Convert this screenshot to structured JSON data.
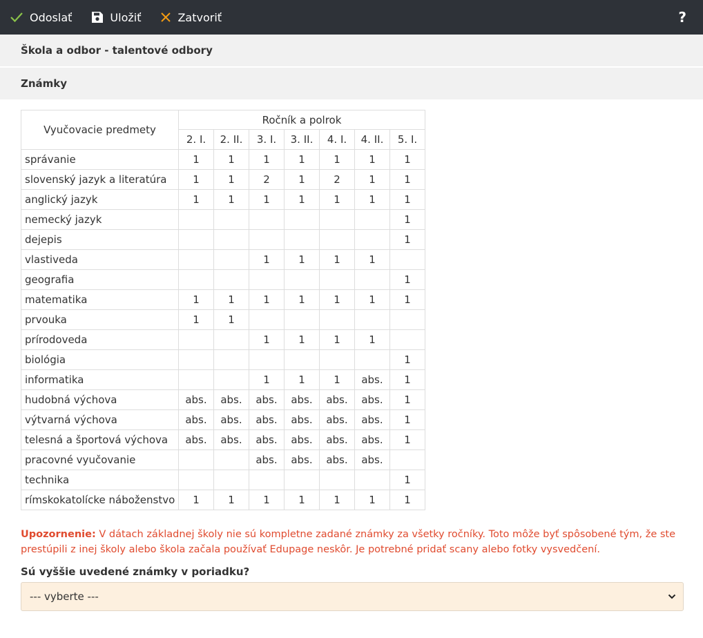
{
  "toolbar": {
    "send_label": "Odoslať",
    "save_label": "Uložiť",
    "close_label": "Zatvoriť",
    "help_label": "?",
    "icons": {
      "send": "checkmark-icon",
      "save": "floppy-disk-icon",
      "close": "close-icon"
    },
    "colors": {
      "send": "#8bc34a",
      "close": "#f39c12"
    }
  },
  "sections": {
    "school": "Škola a odbor - talentové odbory",
    "grades": "Známky"
  },
  "table": {
    "subject_header": "Vyučovacie predmety",
    "group_header": "Ročník a polrok",
    "columns": [
      "2. I.",
      "2. II.",
      "3. I.",
      "3. II.",
      "4. I.",
      "4. II.",
      "5. I."
    ],
    "rows": [
      {
        "subject": "správanie",
        "values": [
          "1",
          "1",
          "1",
          "1",
          "1",
          "1",
          "1"
        ]
      },
      {
        "subject": "slovenský jazyk a literatúra",
        "values": [
          "1",
          "1",
          "2",
          "1",
          "2",
          "1",
          "1"
        ]
      },
      {
        "subject": "anglický jazyk",
        "values": [
          "1",
          "1",
          "1",
          "1",
          "1",
          "1",
          "1"
        ]
      },
      {
        "subject": "nemecký jazyk",
        "values": [
          "",
          "",
          "",
          "",
          "",
          "",
          "1"
        ]
      },
      {
        "subject": "dejepis",
        "values": [
          "",
          "",
          "",
          "",
          "",
          "",
          "1"
        ]
      },
      {
        "subject": "vlastiveda",
        "values": [
          "",
          "",
          "1",
          "1",
          "1",
          "1",
          ""
        ]
      },
      {
        "subject": "geografia",
        "values": [
          "",
          "",
          "",
          "",
          "",
          "",
          "1"
        ]
      },
      {
        "subject": "matematika",
        "values": [
          "1",
          "1",
          "1",
          "1",
          "1",
          "1",
          "1"
        ]
      },
      {
        "subject": "prvouka",
        "values": [
          "1",
          "1",
          "",
          "",
          "",
          "",
          ""
        ]
      },
      {
        "subject": "prírodoveda",
        "values": [
          "",
          "",
          "1",
          "1",
          "1",
          "1",
          ""
        ]
      },
      {
        "subject": "biológia",
        "values": [
          "",
          "",
          "",
          "",
          "",
          "",
          "1"
        ]
      },
      {
        "subject": "informatika",
        "values": [
          "",
          "",
          "1",
          "1",
          "1",
          "abs.",
          "1"
        ]
      },
      {
        "subject": "hudobná výchova",
        "values": [
          "abs.",
          "abs.",
          "abs.",
          "abs.",
          "abs.",
          "abs.",
          "1"
        ]
      },
      {
        "subject": "výtvarná výchova",
        "values": [
          "abs.",
          "abs.",
          "abs.",
          "abs.",
          "abs.",
          "abs.",
          "1"
        ]
      },
      {
        "subject": "telesná a športová výchova",
        "values": [
          "abs.",
          "abs.",
          "abs.",
          "abs.",
          "abs.",
          "abs.",
          "1"
        ]
      },
      {
        "subject": "pracovné vyučovanie",
        "values": [
          "",
          "",
          "abs.",
          "abs.",
          "abs.",
          "abs.",
          ""
        ]
      },
      {
        "subject": "technika",
        "values": [
          "",
          "",
          "",
          "",
          "",
          "",
          "1"
        ]
      },
      {
        "subject": "rímskokatolícke náboženstvo",
        "values": [
          "1",
          "1",
          "1",
          "1",
          "1",
          "1",
          "1"
        ]
      }
    ]
  },
  "warning": {
    "label": "Upozornenie:",
    "text": " V dátach základnej školy nie sú kompletne zadané známky za všetky ročníky. Toto môže byť spôsobené tým, že ste prestúpili z inej školy alebo škola začala používať Edupage neskôr. Je potrebné pridať scany alebo fotky vysvedčení.",
    "color": "#e04b2f"
  },
  "question": {
    "label": "Sú vyššie uvedené známky v poriadku?",
    "selected": "--- vyberte ---"
  }
}
